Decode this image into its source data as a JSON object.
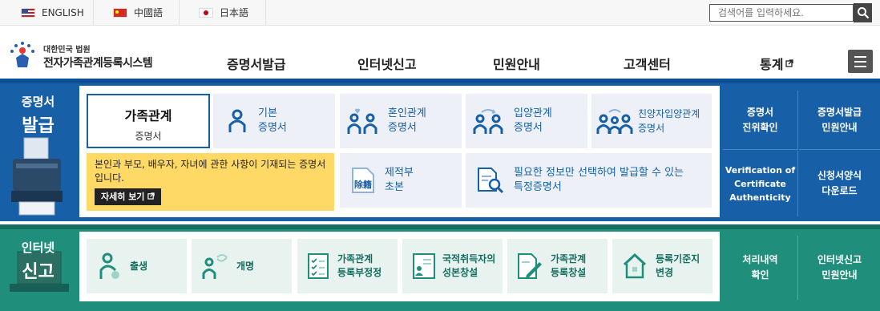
{
  "topbar": {
    "languages": [
      "ENGLISH",
      "中國語",
      "日本語"
    ],
    "search_placeholder": "검색어를 입력하세요."
  },
  "header": {
    "logo_line1": "대한민국 법원",
    "logo_line2": "전자가족관계등록시스템",
    "nav": [
      "증명서발급",
      "인터넷신고",
      "민원안내",
      "고객센터",
      "통계"
    ]
  },
  "issue": {
    "side_line1": "증명서",
    "side_line2": "발급",
    "selected_title": "가족관계",
    "selected_sub": "증명서",
    "description": "본인과 부모, 배우자, 자녀에 관한 사항이 기재되는 증명서입니다.",
    "more_label": "자세히 보기",
    "tiles": [
      {
        "line1": "기본",
        "line2": "증명서"
      },
      {
        "line1": "혼인관계",
        "line2": "증명서"
      },
      {
        "line1": "입양관계",
        "line2": "증명서"
      },
      {
        "line1": "친양자입양관계",
        "line2": "증명서"
      },
      {
        "line1": "제적부",
        "line2": "초본"
      },
      {
        "line1": "필요한 정보만 선택하여 발급할 수 있는",
        "line2": "특정증명서"
      }
    ],
    "right": [
      {
        "line1": "증명서",
        "line2": "진위확인"
      },
      {
        "line1": "증명서발급",
        "line2": "민원안내"
      },
      {
        "line1": "Verification of",
        "line2": "Certificate",
        "line3": "Authenticity"
      },
      {
        "line1": "신청서양식",
        "line2": "다운로드"
      }
    ]
  },
  "report": {
    "side_line1": "인터넷",
    "side_line2": "신고",
    "tiles": [
      {
        "line1": "출생",
        "line2": ""
      },
      {
        "line1": "개명",
        "line2": ""
      },
      {
        "line1": "가족관계",
        "line2": "등록부정정"
      },
      {
        "line1": "국적취득자의",
        "line2": "성본창설"
      },
      {
        "line1": "가족관계",
        "line2": "등록창설"
      },
      {
        "line1": "등록기준지",
        "line2": "변경"
      }
    ],
    "right": [
      {
        "line1": "처리내역",
        "line2": "확인"
      },
      {
        "line1": "인터넷신고",
        "line2": "민원안내"
      }
    ]
  },
  "colors": {
    "primary": "#1760a8",
    "teal": "#1f8f7c",
    "yellow": "#ffd966"
  },
  "icons": [
    "search-icon",
    "menu-icon",
    "external-link-icon",
    "person-icon",
    "couple-icon",
    "family-icon",
    "register-icon",
    "document-search-icon",
    "baby-icon",
    "rename-icon",
    "checklist-icon",
    "id-card-icon",
    "pen-document-icon",
    "house-icon"
  ]
}
